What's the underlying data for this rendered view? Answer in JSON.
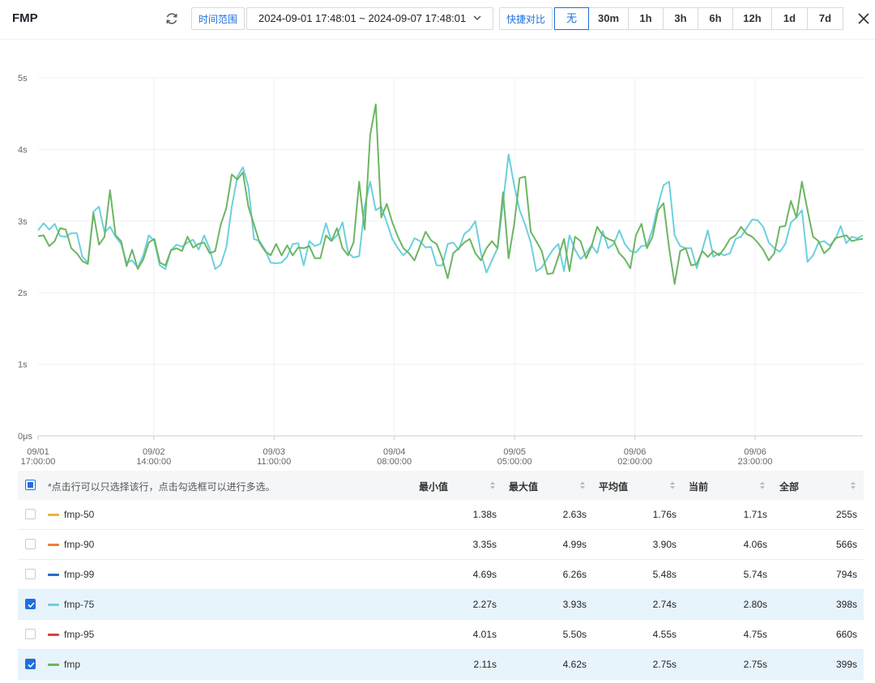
{
  "header": {
    "title": "FMP",
    "time_range_label": "时间范围",
    "date_range": "2024-09-01 17:48:01 ~ 2024-09-07 17:48:01",
    "compare_label": "快捷对比",
    "compare_options": [
      "无",
      "30m",
      "1h",
      "3h",
      "6h",
      "12h",
      "1d",
      "7d"
    ],
    "compare_selected": "无"
  },
  "chart_data": {
    "type": "line",
    "y_ticks": [
      "0μs",
      "1s",
      "2s",
      "3s",
      "4s",
      "5s"
    ],
    "ylim": [
      0,
      5
    ],
    "x_ticks": [
      [
        "09/01",
        "17:00:00"
      ],
      [
        "09/02",
        "14:00:00"
      ],
      [
        "09/03",
        "11:00:00"
      ],
      [
        "09/04",
        "08:00:00"
      ],
      [
        "09/05",
        "05:00:00"
      ],
      [
        "09/06",
        "02:00:00"
      ],
      [
        "09/06",
        "23:00:00"
      ]
    ],
    "x_tick_hours": [
      17,
      38,
      59,
      80,
      101,
      122,
      143
    ],
    "x_range_hours": [
      17.8,
      161.8
    ],
    "grid": true,
    "series": [
      {
        "name": "fmp-75",
        "color": "#6cd0dc",
        "values": [
          2.87,
          2.97,
          2.88,
          2.96,
          2.79,
          2.78,
          2.83,
          2.83,
          2.5,
          2.42,
          3.13,
          3.2,
          2.84,
          2.92,
          2.78,
          2.68,
          2.42,
          2.45,
          2.35,
          2.52,
          2.8,
          2.72,
          2.38,
          2.33,
          2.59,
          2.67,
          2.64,
          2.7,
          2.74,
          2.6,
          2.8,
          2.61,
          2.33,
          2.39,
          2.63,
          3.2,
          3.62,
          3.75,
          3.48,
          2.75,
          2.72,
          2.6,
          2.42,
          2.41,
          2.42,
          2.5,
          2.68,
          2.69,
          2.38,
          2.72,
          2.65,
          2.68,
          2.97,
          2.72,
          2.8,
          2.98,
          2.56,
          2.49,
          2.51,
          3.2,
          3.55,
          3.15,
          3.2,
          2.98,
          2.75,
          2.62,
          2.52,
          2.6,
          2.76,
          2.72,
          2.63,
          2.64,
          2.38,
          2.38,
          2.68,
          2.7,
          2.6,
          2.82,
          2.88,
          3.0,
          2.55,
          2.28,
          2.45,
          2.62,
          3.25,
          3.93,
          3.5,
          3.15,
          2.95,
          2.7,
          2.3,
          2.35,
          2.48,
          2.6,
          2.68,
          2.3,
          2.8,
          2.6,
          2.47,
          2.55,
          2.66,
          2.55,
          2.86,
          2.62,
          2.68,
          2.87,
          2.68,
          2.58,
          2.56,
          2.65,
          2.66,
          2.88,
          3.22,
          3.5,
          3.55,
          2.8,
          2.65,
          2.62,
          2.62,
          2.34,
          2.6,
          2.87,
          2.5,
          2.55,
          2.52,
          2.55,
          2.75,
          2.78,
          2.9,
          3.02,
          3.01,
          2.92,
          2.7,
          2.62,
          2.57,
          2.68,
          2.98,
          3.05,
          3.15,
          2.43,
          2.52,
          2.7,
          2.72,
          2.66,
          2.74,
          2.93,
          2.69,
          2.78,
          2.76,
          2.8
        ]
      },
      {
        "name": "fmp",
        "color": "#6db563",
        "values": [
          2.79,
          2.8,
          2.65,
          2.72,
          2.9,
          2.88,
          2.62,
          2.55,
          2.44,
          2.4,
          3.11,
          2.67,
          2.78,
          3.43,
          2.8,
          2.72,
          2.37,
          2.6,
          2.33,
          2.46,
          2.7,
          2.75,
          2.42,
          2.38,
          2.59,
          2.62,
          2.58,
          2.78,
          2.63,
          2.68,
          2.7,
          2.55,
          2.58,
          2.95,
          3.18,
          3.65,
          3.58,
          3.68,
          3.2,
          2.95,
          2.7,
          2.58,
          2.52,
          2.68,
          2.52,
          2.66,
          2.52,
          2.63,
          2.62,
          2.65,
          2.48,
          2.48,
          2.8,
          2.72,
          2.9,
          2.62,
          2.52,
          2.7,
          3.55,
          2.88,
          4.2,
          4.63,
          3.05,
          3.24,
          2.98,
          2.78,
          2.62,
          2.55,
          2.45,
          2.65,
          2.85,
          2.73,
          2.68,
          2.48,
          2.2,
          2.55,
          2.62,
          2.7,
          2.75,
          2.55,
          2.45,
          2.62,
          2.72,
          2.62,
          3.4,
          2.48,
          2.95,
          3.6,
          3.62,
          2.85,
          2.72,
          2.58,
          2.26,
          2.27,
          2.5,
          2.75,
          2.3,
          2.78,
          2.72,
          2.48,
          2.65,
          2.92,
          2.8,
          2.75,
          2.72,
          2.55,
          2.47,
          2.34,
          2.8,
          2.96,
          2.62,
          2.78,
          3.15,
          3.25,
          2.62,
          2.12,
          2.58,
          2.62,
          2.38,
          2.4,
          2.58,
          2.5,
          2.58,
          2.52,
          2.62,
          2.75,
          2.8,
          2.92,
          2.82,
          2.78,
          2.7,
          2.6,
          2.45,
          2.55,
          2.92,
          2.93,
          3.28,
          3.05,
          3.55,
          3.15,
          2.78,
          2.72,
          2.55,
          2.62,
          2.76,
          2.78,
          2.8,
          2.72,
          2.74,
          2.75
        ]
      }
    ]
  },
  "table": {
    "hint": "*点击行可以只选择该行，点击勾选框可以进行多选。",
    "columns": [
      "最小值",
      "最大值",
      "平均值",
      "当前",
      "全部"
    ],
    "rows": [
      {
        "name": "fmp-50",
        "color": "#e6b53c",
        "checked": false,
        "values": [
          "1.38s",
          "2.63s",
          "1.76s",
          "1.71s",
          "255s"
        ]
      },
      {
        "name": "fmp-90",
        "color": "#e7823a",
        "checked": false,
        "values": [
          "3.35s",
          "4.99s",
          "3.90s",
          "4.06s",
          "566s"
        ]
      },
      {
        "name": "fmp-99",
        "color": "#1f6fc0",
        "checked": false,
        "values": [
          "4.69s",
          "6.26s",
          "5.48s",
          "5.74s",
          "794s"
        ]
      },
      {
        "name": "fmp-75",
        "color": "#6cd0dc",
        "checked": true,
        "values": [
          "2.27s",
          "3.93s",
          "2.74s",
          "2.80s",
          "398s"
        ]
      },
      {
        "name": "fmp-95",
        "color": "#d9413a",
        "checked": false,
        "values": [
          "4.01s",
          "5.50s",
          "4.55s",
          "4.75s",
          "660s"
        ]
      },
      {
        "name": "fmp",
        "color": "#6db563",
        "checked": true,
        "values": [
          "2.11s",
          "4.62s",
          "2.75s",
          "2.75s",
          "399s"
        ]
      }
    ]
  }
}
